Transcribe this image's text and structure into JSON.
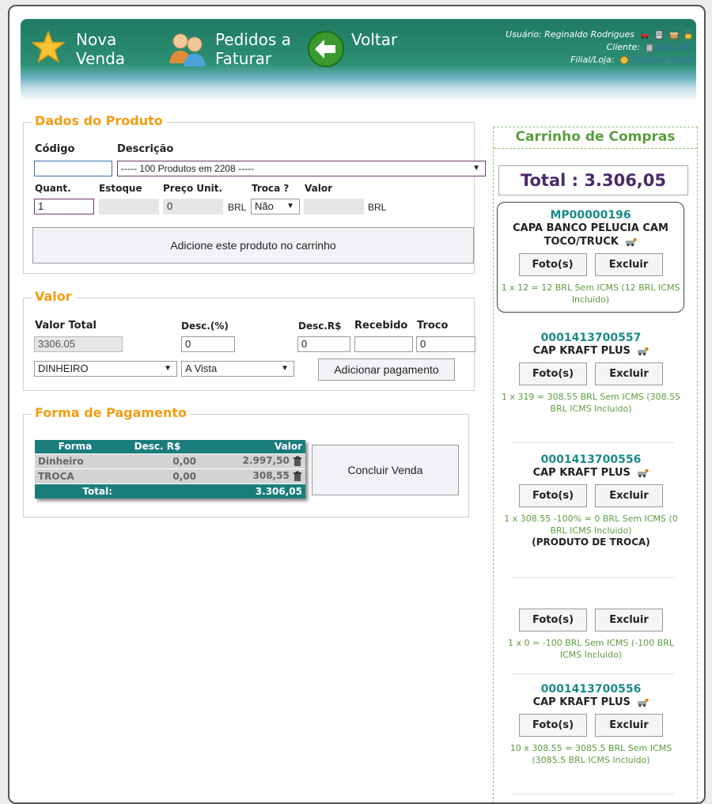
{
  "header": {
    "nav": [
      {
        "line1": "Nova",
        "line2": "Venda",
        "icon": "star-icon"
      },
      {
        "line1": "Pedidos a",
        "line2": "Faturar",
        "icon": "users-icon"
      },
      {
        "line1": "Voltar",
        "line2": "",
        "icon": "back-arrow-icon"
      }
    ],
    "user_label": "Usuário:",
    "user_name": "Reginaldo Rodrigues",
    "client_label": "Cliente:",
    "client_name": "BALCAO",
    "branch_label": "Filial/Loja:",
    "branch_name": "Estoque Geral"
  },
  "product": {
    "legend": "Dados do Produto",
    "code_label": "Código",
    "code_value": "",
    "desc_label": "Descrição",
    "desc_value": "----- 100 Produtos em 2208 -----",
    "qty_label": "Quant.",
    "qty_value": "1",
    "stock_label": "Estoque",
    "stock_value": "",
    "unit_price_label": "Preço Unit.",
    "unit_price_value": "0",
    "currency": "BRL",
    "exchange_label": "Troca ?",
    "exchange_value": "Não",
    "value_label": "Valor",
    "value_value": "",
    "add_button": "Adicione este produto no carrinho"
  },
  "valor": {
    "legend": "Valor",
    "total_label": "Valor Total",
    "total_value": "3306.05",
    "disc_pct_label": "Desc.(%)",
    "disc_pct_value": "0",
    "disc_brl_label": "Desc.R$",
    "disc_brl_value": "0",
    "received_label": "Recebido",
    "received_value": "",
    "change_label": "Troco",
    "change_value": "0",
    "payment_method": "DINHEIRO",
    "payment_term": "A Vista",
    "add_payment_button": "Adicionar pagamento"
  },
  "payment": {
    "legend": "Forma de Pagamento",
    "columns": [
      "Forma",
      "Desc. R$",
      "Valor"
    ],
    "rows": [
      {
        "forma": "Dinheiro",
        "desc": "0,00",
        "valor": "2.997,50"
      },
      {
        "forma": "TROCA",
        "desc": "0,00",
        "valor": "308,55"
      }
    ],
    "total_label": "Total:",
    "total_value": "3.306,05",
    "conclude_button": "Concluir Venda"
  },
  "cart": {
    "title": "Carrinho de Compras",
    "total_label": "Total :",
    "total_value": "3.306,05",
    "photo_label": "Foto(s)",
    "delete_label": "Excluir",
    "items": [
      {
        "code": "MP00000196",
        "desc": "CAPA BANCO PELUCIA CAM TOCO/TRUCK",
        "info": "1 x 12 = 12 BRL Sem ICMS (12 BRL ICMS Incluido)",
        "extra": ""
      },
      {
        "code": "0001413700557",
        "desc": "CAP KRAFT PLUS",
        "info": "1 x 319 = 308.55 BRL Sem ICMS (308.55 BRL ICMS Incluido)",
        "extra": ""
      },
      {
        "code": "0001413700556",
        "desc": "CAP KRAFT PLUS",
        "info": "1 x 308.55 -100% = 0 BRL Sem ICMS (0 BRL ICMS Incluido)",
        "extra": "(PRODUTO DE TROCA)"
      },
      {
        "code": "",
        "desc": "",
        "info": "1 x 0 = -100 BRL Sem ICMS (-100 BRL ICMS Incluido)",
        "extra": ""
      },
      {
        "code": "0001413700556",
        "desc": "CAP KRAFT PLUS",
        "info": "10 x 308.55 = 3085.5 BRL Sem ICMS (3085.5 BRL ICMS Incluido)",
        "extra": ""
      }
    ]
  }
}
